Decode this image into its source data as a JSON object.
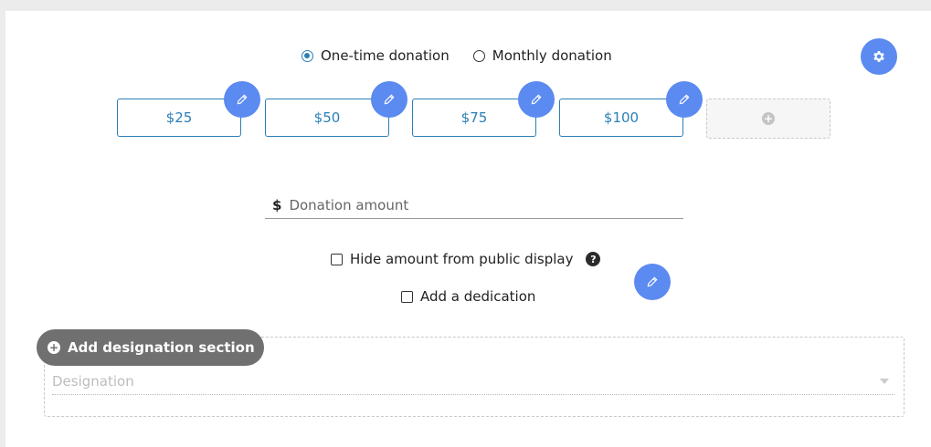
{
  "donation_type": {
    "options": [
      {
        "label": "One-time donation",
        "selected": true
      },
      {
        "label": "Monthly donation",
        "selected": false
      }
    ]
  },
  "amounts": [
    {
      "label": "$25"
    },
    {
      "label": "$50"
    },
    {
      "label": "$75"
    },
    {
      "label": "$100"
    }
  ],
  "add_amount_icon": "plus-icon",
  "settings_icon": "gear-icon",
  "amount_input": {
    "currency": "$",
    "placeholder": "Donation amount",
    "value": ""
  },
  "hide_amount": {
    "label": "Hide amount from public display",
    "checked": false,
    "help": "?"
  },
  "dedication": {
    "label": "Add a dedication",
    "checked": false
  },
  "designation": {
    "add_label": "Add designation section",
    "placeholder": "Designation"
  },
  "colors": {
    "accent": "#2a7fb6",
    "edit_button": "#5b8af0",
    "pill": "#707070"
  }
}
